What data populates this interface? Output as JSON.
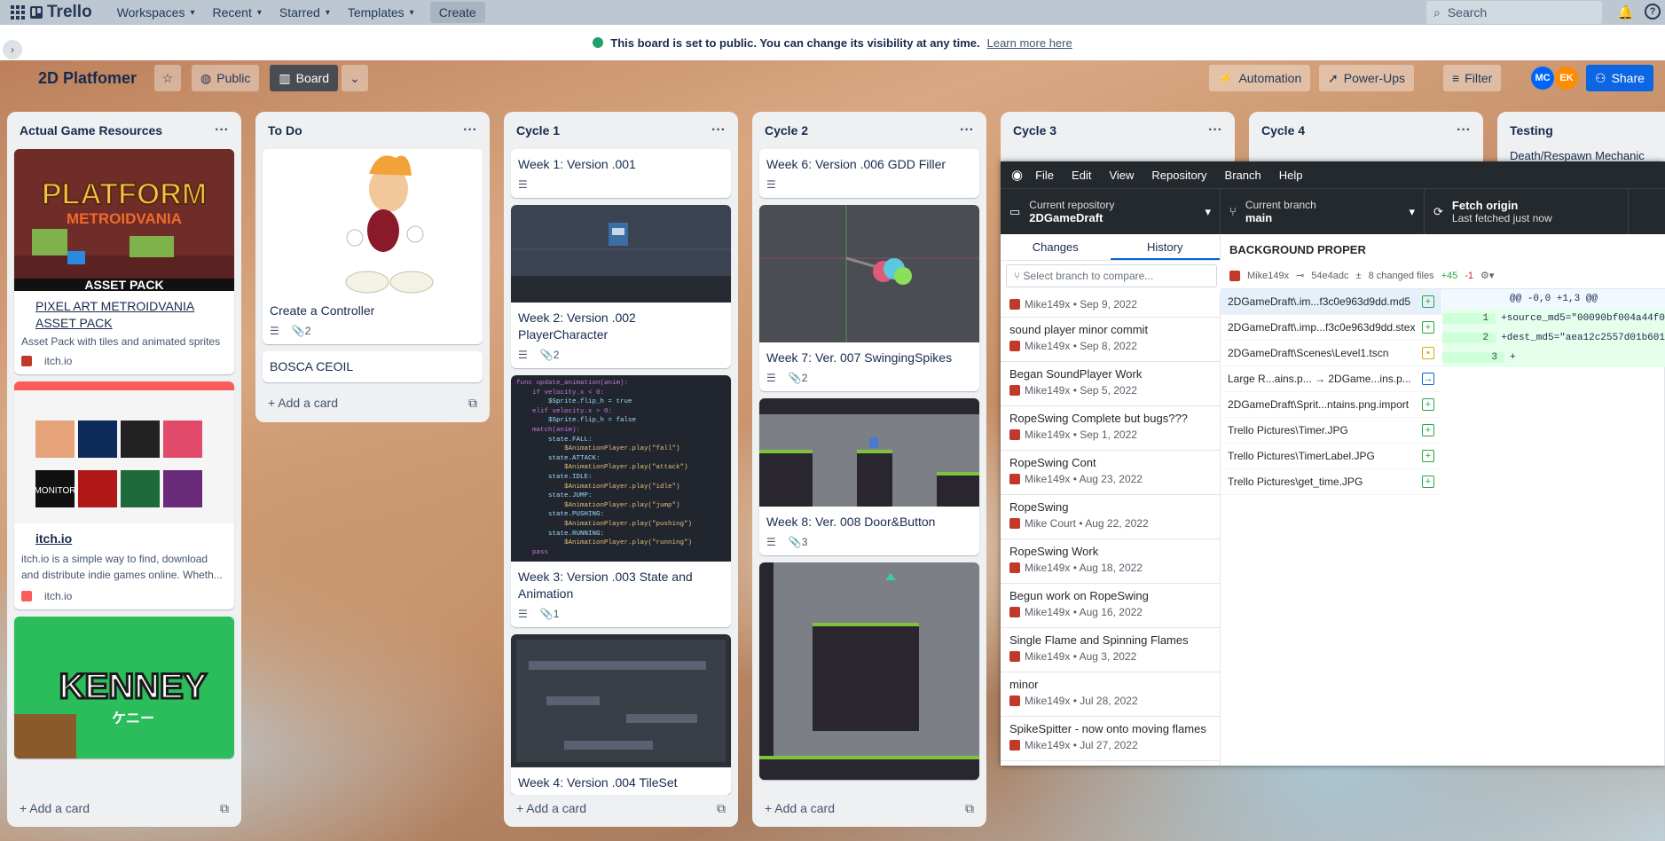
{
  "topbar": {
    "app": "Trello",
    "nav": [
      "Workspaces",
      "Recent",
      "Starred",
      "Templates"
    ],
    "create": "Create",
    "search_placeholder": "Search"
  },
  "banner": {
    "text": "This board is set to public. You can change its visibility at any time.",
    "link": "Learn more here"
  },
  "board": {
    "title": "2D Platfomer",
    "visibility": "Public",
    "view": "Board",
    "automation": "Automation",
    "powerups": "Power-Ups",
    "filter": "Filter",
    "share": "Share",
    "avatars": [
      "MC",
      "EK"
    ]
  },
  "lists": [
    {
      "name": "Actual Game Resources",
      "cards": [
        {
          "title": "PIXEL ART METROIDVANIA ASSET PACK",
          "desc": "Asset Pack with tiles and animated sprites",
          "source": "itch.io",
          "image_text": [
            "PLATFORM",
            "METROIDVANIA",
            "ASSET PACK"
          ]
        },
        {
          "title": "itch.io",
          "desc": "itch.io is a simple way to find, download and distribute indie games online. Wheth...",
          "source": "itch.io",
          "image_text": [
            "MONITOR"
          ]
        },
        {
          "image_text": [
            "KENNEY",
            "ケニー"
          ]
        }
      ],
      "add": "Add a card"
    },
    {
      "name": "To Do",
      "cards": [
        {
          "title": "Create a Controller",
          "attachments": "2"
        },
        {
          "title": "BOSCA CEOIL"
        }
      ],
      "add": "Add a card"
    },
    {
      "name": "Cycle 1",
      "cards": [
        {
          "title": "Week 1: Version .001"
        },
        {
          "title": "Week 2: Version .002 PlayerCharacter",
          "attachments": "2"
        },
        {
          "title": "Week 3: Version .003 State and Animation",
          "attachments": "1"
        },
        {
          "title": "Week 4: Version .004 TileSet"
        }
      ],
      "add": "Add a card",
      "code": [
        "func update_animation(anim):",
        "    if velocity.x < 0:",
        "        $Sprite.flip_h = true",
        "    elif velocity.x > 0:",
        "        $Sprite.flip_h = false",
        "    match(anim):",
        "        state.FALL:",
        "            $AnimationPlayer.play(\"fall\")",
        "        state.ATTACK:",
        "            $AnimationPlayer.play(\"attack\")",
        "        state.IDLE:",
        "            $AnimationPlayer.play(\"idle\")",
        "        state.JUMP:",
        "            $AnimationPlayer.play(\"jump\")",
        "        state.PUSHING:",
        "            $AnimationPlayer.play(\"pushing\")",
        "        state.RUNNING:",
        "            $AnimationPlayer.play(\"running\")",
        "    pass"
      ]
    },
    {
      "name": "Cycle 2",
      "cards": [
        {
          "title": "Week 6: Version .006 GDD Filler"
        },
        {
          "title": "Week 7: Ver. 007 SwingingSpikes",
          "attachments": "2"
        },
        {
          "title": "Week 8: Ver. 008 Door&Button",
          "attachments": "3"
        }
      ],
      "add": "Add a card"
    },
    {
      "name": "Cycle 3"
    },
    {
      "name": "Cycle 4"
    },
    {
      "name": "Testing",
      "peek": "Death/Respawn Mechanic"
    }
  ],
  "github": {
    "menu": [
      "File",
      "Edit",
      "View",
      "Repository",
      "Branch",
      "Help"
    ],
    "repo_label": "Current repository",
    "repo": "2DGameDraft",
    "branch_label": "Current branch",
    "branch": "main",
    "fetch": "Fetch origin",
    "fetch_sub": "Last fetched just now",
    "tabs": [
      "Changes",
      "History"
    ],
    "compare_placeholder": "Select branch to compare...",
    "commits": [
      {
        "title": "",
        "meta": "Mike149x • Sep 9, 2022"
      },
      {
        "title": "sound player minor commit",
        "meta": "Mike149x • Sep 8, 2022"
      },
      {
        "title": "Began SoundPlayer Work",
        "meta": "Mike149x • Sep 5, 2022"
      },
      {
        "title": "RopeSwing Complete but bugs???",
        "meta": "Mike149x • Sep 1, 2022"
      },
      {
        "title": "RopeSwing Cont",
        "meta": "Mike149x • Aug 23, 2022"
      },
      {
        "title": "RopeSwing",
        "meta": "Mike Court • Aug 22, 2022"
      },
      {
        "title": "RopeSwing Work",
        "meta": "Mike149x • Aug 18, 2022"
      },
      {
        "title": "Begun work on RopeSwing",
        "meta": "Mike149x • Aug 16, 2022"
      },
      {
        "title": "Single Flame and Spinning Flames",
        "meta": "Mike149x • Aug 3, 2022"
      },
      {
        "title": "minor",
        "meta": "Mike149x • Jul 28, 2022"
      },
      {
        "title": "SpikeSpitter - now onto moving flames",
        "meta": "Mike149x • Jul 27, 2022"
      }
    ],
    "detail": {
      "title": "BACKGROUND PROPER",
      "author": "Mike149x",
      "sha": "54e4adc",
      "changed": "8 changed files",
      "plus": "+45",
      "minus": "-1"
    },
    "files": [
      {
        "name": "2DGameDraft\\.im...f3c0e963d9dd.md5",
        "status": "+"
      },
      {
        "name": "2DGameDraft\\.imp...f3c0e963d9dd.stex",
        "status": "+"
      },
      {
        "name": "2DGameDraft\\Scenes\\Level1.tscn",
        "status": "•"
      },
      {
        "name": "Large R...ains.p...  →  2DGame...ins.p...",
        "status": "→"
      },
      {
        "name": "2DGameDraft\\Sprit...ntains.png.import",
        "status": "+"
      },
      {
        "name": "Trello Pictures\\Timer.JPG",
        "status": "+"
      },
      {
        "name": "Trello Pictures\\TimerLabel.JPG",
        "status": "+"
      },
      {
        "name": "Trello Pictures\\get_time.JPG",
        "status": "+"
      }
    ],
    "diff": [
      {
        "n": "",
        "t": "@@ -0,0 +1,3 @@"
      },
      {
        "n": "1",
        "t": "+source_md5=\"00090bf004a44f0"
      },
      {
        "n": "2",
        "t": "+dest_md5=\"aea12c2557d01b601"
      },
      {
        "n": "3",
        "t": "+"
      }
    ]
  }
}
